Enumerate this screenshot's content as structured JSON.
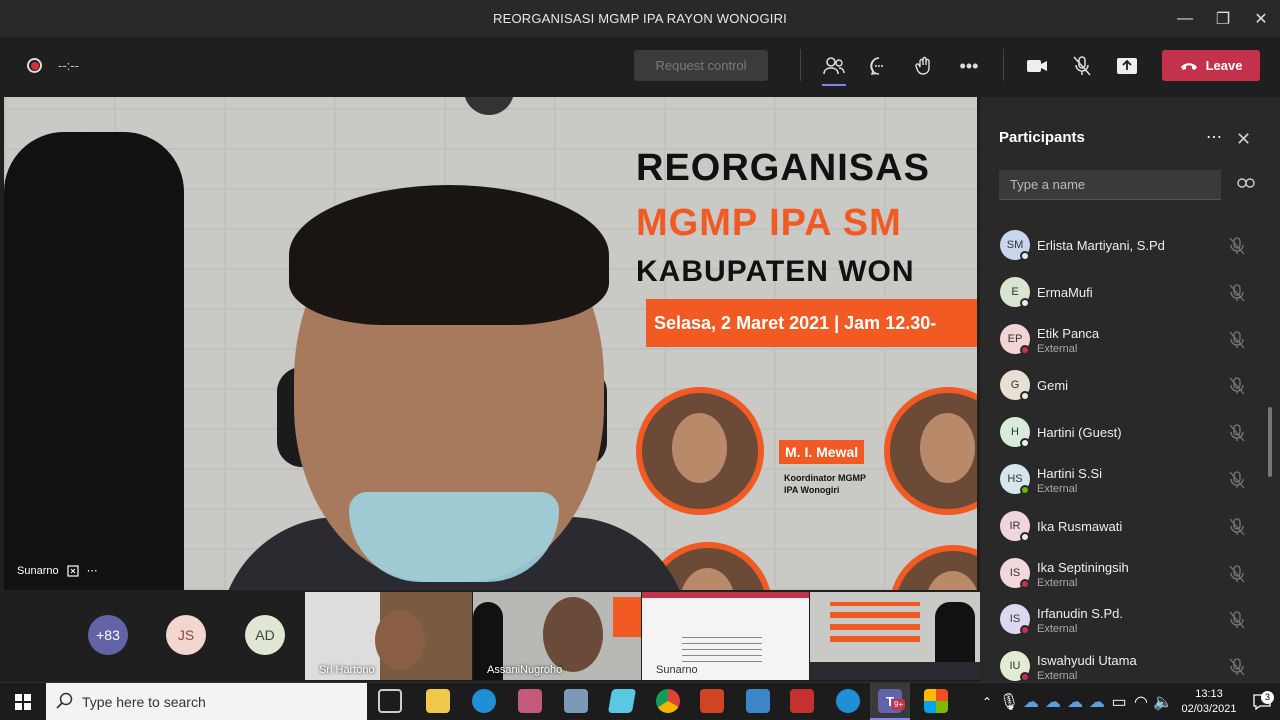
{
  "window": {
    "title": "REORGANISASI MGMP IPA RAYON WONOGIRI",
    "minimize": "—",
    "maximize": "❐",
    "close": "✕"
  },
  "toolbar": {
    "timer": "--:--",
    "request_control": "Request control",
    "leave_label": "Leave"
  },
  "stage": {
    "banner_line1": "REORGANISAS",
    "banner_line2": "MGMP IPA SM",
    "banner_line3": "KABUPATEN WON",
    "banner_date": "Selasa, 2 Maret 2021  | Jam 12.30-",
    "speaker_name": "M. I. Mewal",
    "speaker_role_1": "Koordinator MGMP",
    "speaker_role_2": "IPA Wonogiri",
    "presenter_label": "Sunarno"
  },
  "bottom_strip": {
    "overflow_count": "+83",
    "avatar_js": "JS",
    "avatar_ad": "AD",
    "thumbs": [
      {
        "name": "Sri Hartono"
      },
      {
        "name": "AssaniNugroho"
      },
      {
        "name": "Sunarno"
      },
      {
        "name": ""
      }
    ]
  },
  "panel": {
    "title": "Participants",
    "search_placeholder": "Type a name",
    "participants": [
      {
        "initials": "SM",
        "name": "Erlista Martiyani, S.Pd",
        "sub": "",
        "color": "#c7d6ec",
        "status": "#eaeaea"
      },
      {
        "initials": "E",
        "name": "ErmaMufi",
        "sub": "",
        "color": "#d8e6cf",
        "status": "#eaeaea"
      },
      {
        "initials": "EP",
        "name": "Etik Panca",
        "sub": "External",
        "color": "#f2d4d4",
        "status": "#c4314b"
      },
      {
        "initials": "G",
        "name": "Gemi",
        "sub": "",
        "color": "#e9e0d4",
        "status": "#eaeaea"
      },
      {
        "initials": "H",
        "name": "Hartini (Guest)",
        "sub": "",
        "color": "#d8ecd9",
        "status": "#eaeaea"
      },
      {
        "initials": "HS",
        "name": "Hartini S.Si",
        "sub": "External",
        "color": "#d6e6ec",
        "status": "#6bb700"
      },
      {
        "initials": "IR",
        "name": "Ika Rusmawati",
        "sub": "",
        "color": "#f0d6dc",
        "status": "#eaeaea"
      },
      {
        "initials": "IS",
        "name": "Ika Septiningsih",
        "sub": "External",
        "color": "#f2d7dc",
        "status": "#c4314b"
      },
      {
        "initials": "IS",
        "name": "Irfanudin S.Pd.",
        "sub": "External",
        "color": "#ddd8ef",
        "status": "#c4314b"
      },
      {
        "initials": "IU",
        "name": "Iswahyudi Utama",
        "sub": "External",
        "color": "#e2ebd3",
        "status": "#c4314b"
      }
    ]
  },
  "taskbar": {
    "search_placeholder": "Type here to search",
    "time": "13:13",
    "date": "02/03/2021",
    "notifications": "3",
    "teams_badge": "9+"
  },
  "colors": {
    "accent": "#7f85f5",
    "leave": "#c4314b",
    "banner_orange": "#f15a22"
  }
}
